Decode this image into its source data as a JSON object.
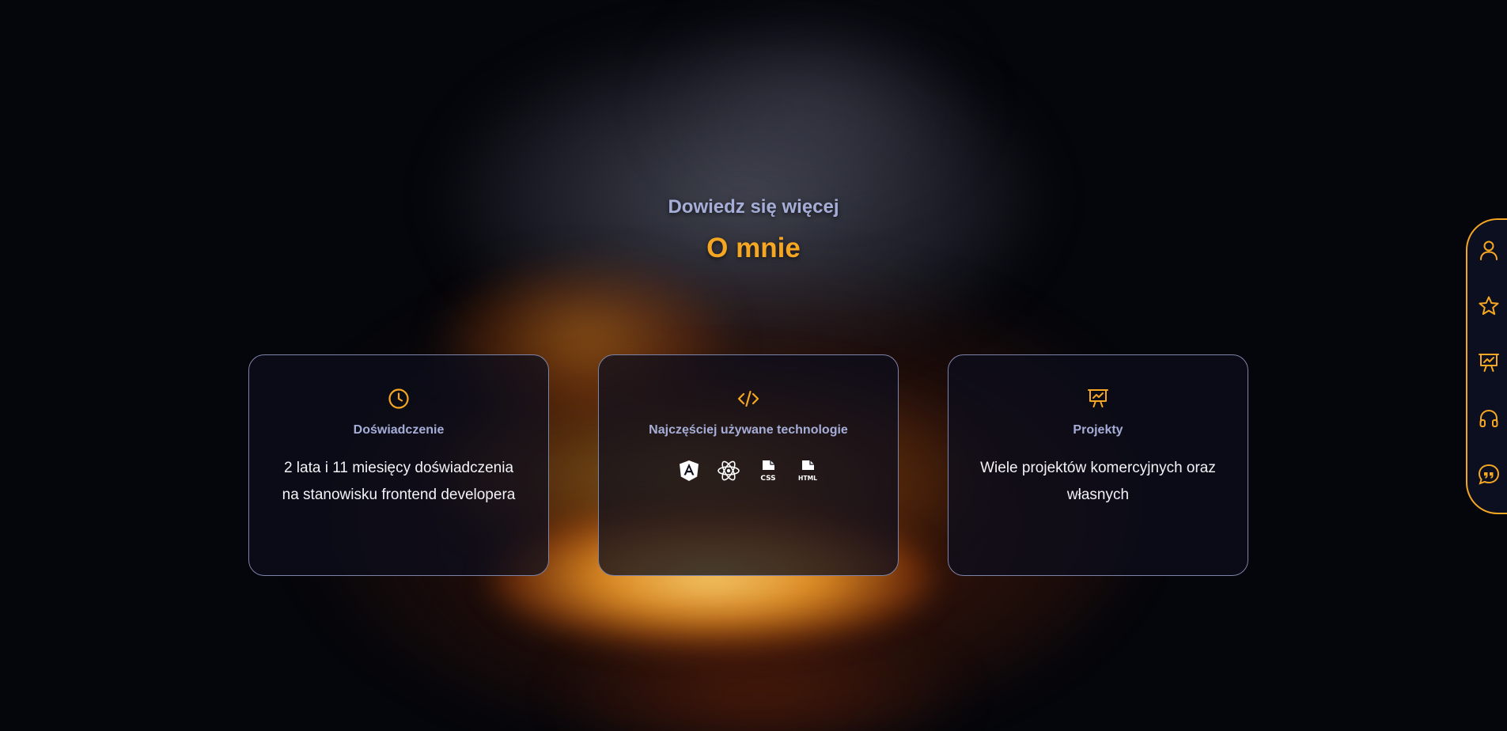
{
  "section": {
    "subtitle": "Dowiedz się więcej",
    "title": "O mnie"
  },
  "cards": [
    {
      "icon": "clock-icon",
      "title": "Doświadczenie",
      "text": "2 lata i 11 miesięcy doświadczenia na stanowisku frontend developera"
    },
    {
      "icon": "code-icon",
      "title": "Najczęściej używane technologie",
      "technologies": [
        "angular-icon",
        "react-icon",
        "css-file-icon",
        "html-file-icon"
      ]
    },
    {
      "icon": "presentation-icon",
      "title": "Projekty",
      "text": "Wiele projektów komercyjnych oraz własnych"
    }
  ],
  "sidenav": {
    "items": [
      "user-icon",
      "star-icon",
      "presentation-icon",
      "headphones-icon",
      "quote-icon"
    ]
  },
  "colors": {
    "accent": "#f5a623",
    "muted": "#a6aed8",
    "card_border": "#7e83a8",
    "text": "#f3f3f6"
  }
}
